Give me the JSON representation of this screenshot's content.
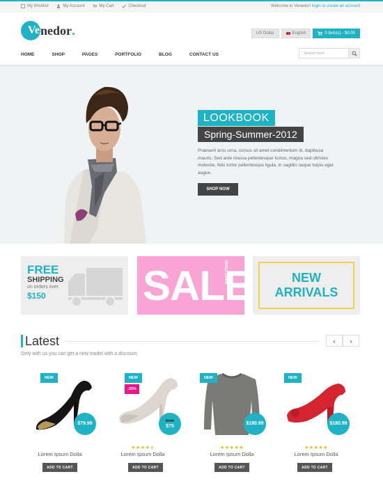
{
  "topbar": {
    "links": [
      "My Wishlist",
      "My Account",
      "My Cart",
      "Checkout"
    ],
    "welcome": "Welcome to Venedor!",
    "account_link": "login or create an account"
  },
  "logo": {
    "initial": "Ve",
    "rest": "nedor",
    "dot": "."
  },
  "header": {
    "currency": "US Dollar",
    "language": "English",
    "cart": "0 item(s) - $0.00"
  },
  "nav": [
    "HOME",
    "SHOP",
    "PAGES",
    "PORTFOLIO",
    "BLOG",
    "CONTACT US"
  ],
  "search": {
    "placeholder": "Search here"
  },
  "hero": {
    "title": "LOOKBOOK",
    "subtitle": "Spring-Summer-2012",
    "text": "Praesent arcu urna, cursus sit amet condimentum id, dapibusa mauris. Sed ante massa pellentesque luctus, magna sed ultricies molestie, felis tortor pellentesque ligula, in sagittis neque turpis eget augue.",
    "button": "SHOP NOW"
  },
  "banners": {
    "free": "FREE",
    "shipping": "SHIPPING",
    "orders": "on orders over",
    "price": "$150",
    "sale": "SALE",
    "many": "MANY ITEMS",
    "new": "NEW",
    "arrivals": "ARRIVALS"
  },
  "latest": {
    "title": "Latest",
    "subtitle": "Only with us you can get a new model with a discount.",
    "prev": "‹",
    "next": "›"
  },
  "products": [
    {
      "badge": "NEW",
      "discount": "",
      "old_price": "",
      "price": "$79.99",
      "rating": 0,
      "name": "Lorem Ipsum Dolla",
      "button": "ADD TO CART"
    },
    {
      "badge": "NEW",
      "discount": "-25%",
      "old_price": "$100",
      "price": "$75",
      "rating": 4.5,
      "stars": "★★★★✯",
      "name": "Lorem Ipsum Dolla",
      "button": "ADD TO CART"
    },
    {
      "badge": "NEW",
      "discount": "",
      "old_price": "",
      "price": "$180.99",
      "rating": 5,
      "stars": "★★★★★",
      "name": "Lorem Ipsum Dolla",
      "button": "ADD TO CART"
    },
    {
      "badge": "NEW",
      "discount": "",
      "old_price": "",
      "price": "$180.99",
      "rating": 5,
      "stars": "★★★★★",
      "name": "Lorem Ipsum Dolla",
      "button": "ADD TO CART"
    }
  ],
  "colors": {
    "accent": "#1eb2c4",
    "sale_pink": "#f8a5d6",
    "discount": "#e6198a",
    "dark": "#444444",
    "frame_yellow": "#f2d24a"
  }
}
